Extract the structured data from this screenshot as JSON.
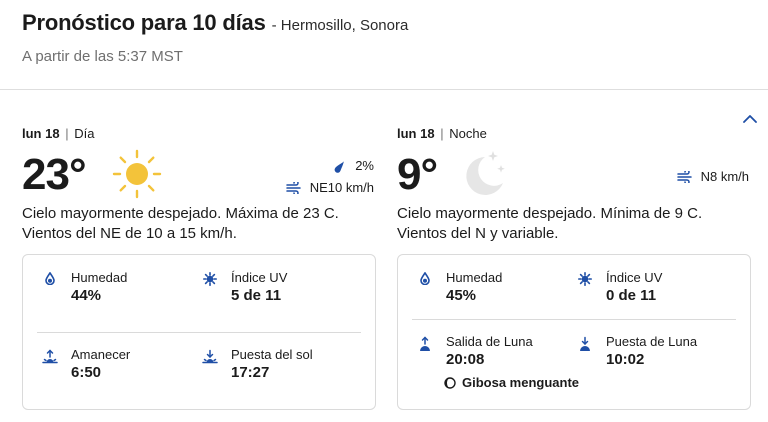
{
  "header": {
    "title": "Pronóstico para 10 días",
    "location": "- Hermosillo, Sonora",
    "updated": "A partir de las 5:37 MST"
  },
  "day": {
    "date": "lun 18",
    "separator": "|",
    "period": "Día",
    "temperature": "23°",
    "icon": "sun-icon",
    "precipitation": "2%",
    "wind": "NE10 km/h",
    "description": "Cielo mayormente despejado. Máxima de 23 C. Vientos del NE de 10 a 15 km/h.",
    "details": {
      "humidity_label": "Humedad",
      "humidity_value": "44%",
      "uv_label": "Índice UV",
      "uv_value": "5 de 11",
      "sunrise_label": "Amanecer",
      "sunrise_value": "6:50",
      "sunset_label": "Puesta del sol",
      "sunset_value": "17:27"
    }
  },
  "night": {
    "date": "lun 18",
    "separator": "|",
    "period": "Noche",
    "temperature": "9°",
    "icon": "moon-stars-icon",
    "wind": "N8 km/h",
    "description": "Cielo mayormente despejado. Mínima de 9 C. Vientos del N y variable.",
    "details": {
      "humidity_label": "Humedad",
      "humidity_value": "45%",
      "uv_label": "Índice UV",
      "uv_value": "0 de 11",
      "moonrise_label": "Salida de Luna",
      "moonrise_value": "20:08",
      "moonset_label": "Puesta de Luna",
      "moonset_value": "10:02",
      "moon_phase": "Gibosa menguante"
    }
  },
  "colors": {
    "icon_blue": "#1f4fa6",
    "sun_yellow": "#f3c33a",
    "divider": "#dedede",
    "subtitle_gray": "#6f6f6f"
  }
}
